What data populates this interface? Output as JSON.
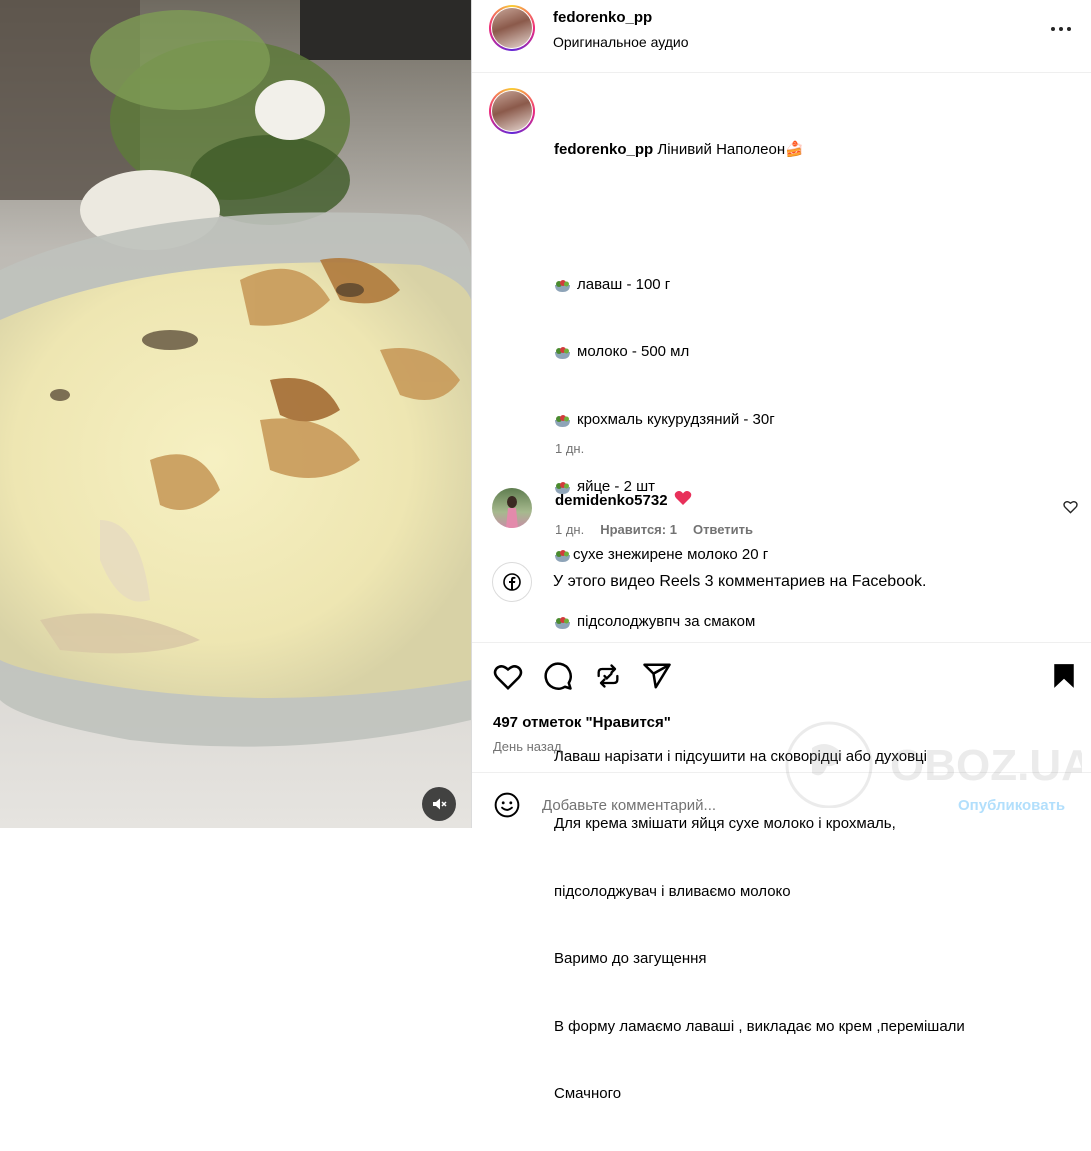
{
  "header": {
    "username": "fedorenko_pp",
    "audio": "Оригинальное аудио",
    "more_icon": "more-dots-icon"
  },
  "caption": {
    "username": "fedorenko_pp",
    "title": "Лінивий Наполеон🍰",
    "ingredients": [
      "лаваш - 100 г",
      "молоко - 500 мл",
      "крохмаль кукурудзяний - 30г",
      "яйце - 2 шт",
      "сухе знежирене молоко 20 г",
      "підсолоджувпч за смаком"
    ],
    "steps": [
      "Лаваш нарізати і підсушити на сковорідці або духовці",
      "Для крема змішати яйця сухе молоко і крохмаль,",
      "підсолоджувач і вливаємо молоко",
      "Варимо до загущення",
      "В форму ламаємо лаваші , викладає мо крем ,перемішали",
      "Смачного"
    ],
    "time": "1 дн."
  },
  "comment": {
    "username": "demidenko5732",
    "emoji": "❤️",
    "time": "1 дн.",
    "likes": "Нравится: 1",
    "reply": "Ответить"
  },
  "facebook_note": "У этого видео Reels 3 комментариев на Facebook.",
  "likes": "497 отметок \"Нравится\"",
  "posted": "День назад",
  "comment_box": {
    "placeholder": "Добавьте комментарий...",
    "publish": "Опубликовать"
  },
  "watermark": "OBOZ.UA",
  "colors": {
    "publish": "#b2dffc",
    "heart": "#ed4956",
    "text_secondary": "#737373"
  }
}
